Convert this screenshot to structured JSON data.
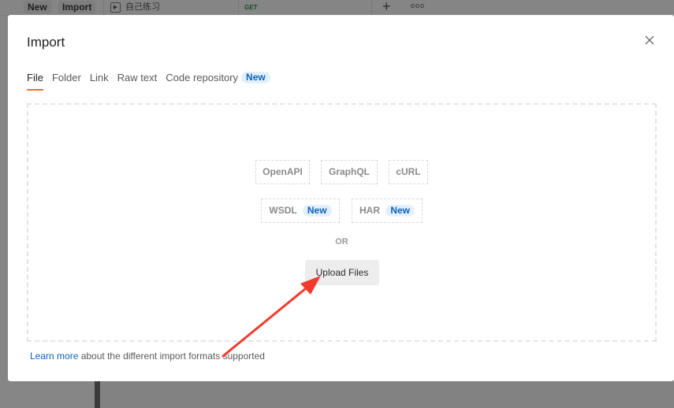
{
  "background": {
    "new_button": "New",
    "import_button": "Import",
    "tab_label": "自己练习",
    "method": "GET",
    "add_tab_icon": "plus-icon",
    "more_icon": "more-horizontal-icon"
  },
  "modal": {
    "title": "Import",
    "close_icon": "close-icon",
    "tabs": [
      {
        "label": "File",
        "active": true
      },
      {
        "label": "Folder"
      },
      {
        "label": "Link"
      },
      {
        "label": "Raw text"
      },
      {
        "label": "Code repository",
        "badge": "New"
      }
    ],
    "formats_row1": [
      "OpenAPI",
      "GraphQL",
      "cURL"
    ],
    "formats_row2": [
      {
        "label": "WSDL",
        "badge": "New"
      },
      {
        "label": "HAR",
        "badge": "New"
      }
    ],
    "or_text": "OR",
    "upload_button": "Upload Files",
    "footer_link": "Learn more",
    "footer_text": " about the different import formats supported"
  },
  "colors": {
    "accent": "#ff6c37",
    "link": "#0b62b8",
    "badge_bg": "#e3f0fb",
    "annotation_arrow": "#f23a2c"
  }
}
